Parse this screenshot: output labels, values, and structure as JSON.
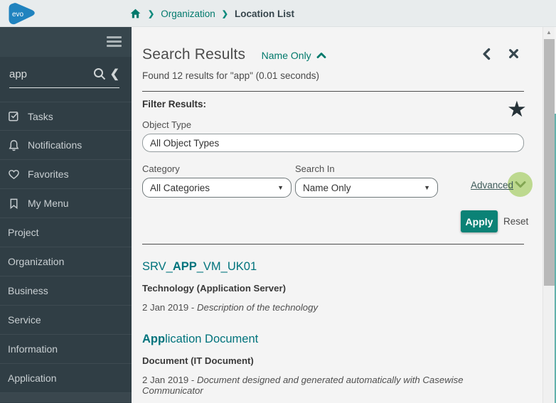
{
  "topbar": {
    "logo_text": "evo",
    "breadcrumb": [
      "Organization",
      "Location List"
    ]
  },
  "sidebar": {
    "search_value": "app",
    "items": [
      {
        "label": "Tasks",
        "icon": "tasks-icon"
      },
      {
        "label": "Notifications",
        "icon": "bell-icon"
      },
      {
        "label": "Favorites",
        "icon": "heart-icon"
      },
      {
        "label": "My Menu",
        "icon": "bookmark-icon"
      },
      {
        "label": "Project"
      },
      {
        "label": "Organization"
      },
      {
        "label": "Business"
      },
      {
        "label": "Service"
      },
      {
        "label": "Information"
      },
      {
        "label": "Application"
      }
    ]
  },
  "header": {
    "title": "Search Results",
    "scope": "Name Only",
    "summary": "Found 12 results for \"app\" (0.01 seconds)"
  },
  "filter": {
    "heading": "Filter Results:",
    "object_type_label": "Object Type",
    "object_type_value": "All Object Types",
    "category_label": "Category",
    "category_value": "All Categories",
    "search_in_label": "Search In",
    "search_in_value": "Name Only",
    "advanced_label": "Advanced",
    "apply_label": "Apply",
    "reset_label": "Reset"
  },
  "results": [
    {
      "title_pre": "SRV_",
      "title_bold": "APP",
      "title_post": "_VM_UK01",
      "subtitle": "Technology (Application Server)",
      "date": "2 Jan 2019 - ",
      "description": "Description of the technology"
    },
    {
      "title_pre": "",
      "title_bold": "App",
      "title_post": "lication Document",
      "subtitle": "Document (IT Document)",
      "date": "2 Jan 2019 - ",
      "description": "Document designed and generated automatically with Casewise Communicator"
    }
  ],
  "icons": {
    "home": "home-icon",
    "search": "search-icon",
    "star": "★",
    "select_caret": "▼",
    "scroll_arrow": "▲"
  },
  "colors": {
    "accent_teal": "#00796b",
    "link_teal": "#00737c",
    "apply_green": "#0b8276",
    "logo_blue": "#2083bf",
    "advanced_circle": "#bdd98f",
    "sidebar_bg": "#303e45"
  }
}
